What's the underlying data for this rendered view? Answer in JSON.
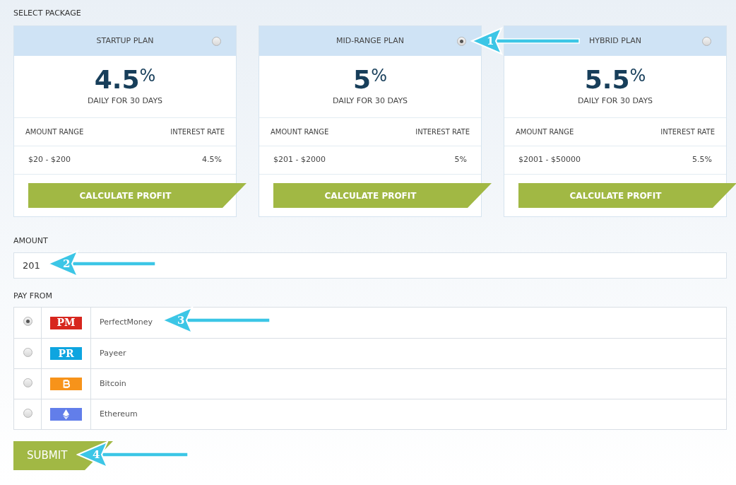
{
  "section_title": "SELECT PACKAGE",
  "plans": [
    {
      "name": "STARTUP PLAN",
      "selected": false,
      "rate": "4.5",
      "percent_sign": "%",
      "period": "DAILY FOR 30 DAYS",
      "col_left": "AMOUNT RANGE",
      "col_right": "INTEREST RATE",
      "range": "$20 - $200",
      "interest": "4.5%",
      "button": "CALCULATE PROFIT"
    },
    {
      "name": "MID-RANGE PLAN",
      "selected": true,
      "rate": "5",
      "percent_sign": "%",
      "period": "DAILY FOR 30 DAYS",
      "col_left": "AMOUNT RANGE",
      "col_right": "INTEREST RATE",
      "range": "$201 - $2000",
      "interest": "5%",
      "button": "CALCULATE PROFIT"
    },
    {
      "name": "HYBRID PLAN",
      "selected": false,
      "rate": "5.5",
      "percent_sign": "%",
      "period": "DAILY FOR 30 DAYS",
      "col_left": "AMOUNT RANGE",
      "col_right": "INTEREST RATE",
      "range": "$2001 - $50000",
      "interest": "5.5%",
      "button": "CALCULATE PROFIT"
    }
  ],
  "amount": {
    "label": "AMOUNT",
    "value": "201"
  },
  "pay_from": {
    "label": "PAY FROM",
    "methods": [
      {
        "name": "PerfectMoney",
        "selected": true,
        "kind": "text",
        "logo_text": "PM",
        "color": "#d7261e"
      },
      {
        "name": "Payeer",
        "selected": false,
        "kind": "text",
        "logo_text": "PR",
        "color": "#0ea5e0"
      },
      {
        "name": "Bitcoin",
        "selected": false,
        "kind": "bitcoin",
        "color": "#f7931a"
      },
      {
        "name": "Ethereum",
        "selected": false,
        "kind": "ethereum",
        "color": "#627eea"
      }
    ]
  },
  "submit": "SUBMIT",
  "annotations": [
    {
      "label": "1"
    },
    {
      "label": "2"
    },
    {
      "label": "3"
    },
    {
      "label": "4"
    }
  ]
}
